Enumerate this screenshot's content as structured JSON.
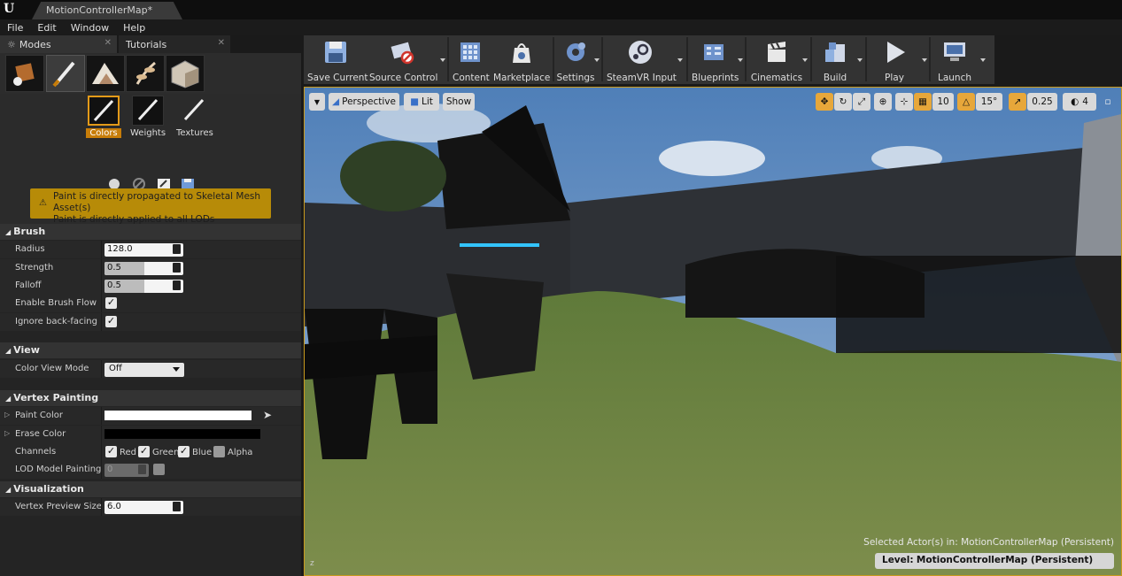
{
  "app": {
    "logo_icon": "unreal-logo-icon",
    "document_tab": "MotionControllerMap*"
  },
  "menu": [
    "File",
    "Edit",
    "Window",
    "Help"
  ],
  "left_tabs": [
    {
      "label": "Modes",
      "icon": "modes-icon"
    },
    {
      "label": "Tutorials"
    }
  ],
  "mode_icons": [
    "place-mode-icon",
    "paint-mode-icon",
    "landscape-mode-icon",
    "foliage-mode-icon",
    "geometry-mode-icon"
  ],
  "paint_tools": [
    {
      "label": "Colors",
      "active": true
    },
    {
      "label": "Weights",
      "active": false
    },
    {
      "label": "Textures",
      "active": false
    }
  ],
  "warning": {
    "line1": "Paint is directly propagated to Skeletal Mesh Asset(s)",
    "line2": "Paint is directly applied to all LODs"
  },
  "sections": {
    "brush": "Brush",
    "view": "View",
    "vertex_painting": "Vertex Painting",
    "visualization": "Visualization"
  },
  "brush": {
    "radius_label": "Radius",
    "radius": "128.0",
    "strength_label": "Strength",
    "strength": "0.5",
    "falloff_label": "Falloff",
    "falloff": "0.5",
    "flow_label": "Enable Brush Flow",
    "flow_checked": true,
    "backface_label": "Ignore back-facing",
    "backface_checked": true
  },
  "view": {
    "color_view_label": "Color View Mode",
    "color_view_value": "Off"
  },
  "vertex_painting": {
    "paint_color_label": "Paint Color",
    "paint_color": "#ffffff",
    "erase_color_label": "Erase Color",
    "erase_color": "#000000",
    "channels_label": "Channels",
    "channels": [
      {
        "label": "Red",
        "checked": true
      },
      {
        "label": "Green",
        "checked": true
      },
      {
        "label": "Blue",
        "checked": true
      },
      {
        "label": "Alpha",
        "checked": false
      }
    ],
    "lod_label": "LOD Model Painting",
    "lod_value": "0"
  },
  "visualization": {
    "vertex_size_label": "Vertex Preview Size",
    "vertex_size_value": "6.0"
  },
  "toolbar": [
    {
      "label": "Save Current",
      "icon": "save-icon",
      "arrow": false
    },
    {
      "label": "Source Control",
      "icon": "source-control-icon",
      "arrow": true
    },
    {
      "label": "Content",
      "icon": "content-icon",
      "arrow": false
    },
    {
      "label": "Marketplace",
      "icon": "marketplace-icon",
      "arrow": false
    },
    {
      "label": "Settings",
      "icon": "settings-icon",
      "arrow": true
    },
    {
      "label": "SteamVR Input",
      "icon": "steamvr-icon",
      "arrow": true
    },
    {
      "label": "Blueprints",
      "icon": "blueprints-icon",
      "arrow": true
    },
    {
      "label": "Cinematics",
      "icon": "cinematics-icon",
      "arrow": true
    },
    {
      "label": "Build",
      "icon": "build-icon",
      "arrow": true
    },
    {
      "label": "Play",
      "icon": "play-icon",
      "arrow": true
    },
    {
      "label": "Launch",
      "icon": "launch-icon",
      "arrow": true
    }
  ],
  "viewport": {
    "perspective": "Perspective",
    "lit": "Lit",
    "show": "Show",
    "grid_snap": "10",
    "rotation_snap": "15°",
    "scale_snap": "0.25",
    "camera_speed": "4",
    "selected_label": "Selected Actor(s) in:",
    "selected_value": "MotionControllerMap (Persistent)",
    "level_label": "Level:",
    "level_value": "MotionControllerMap (Persistent)"
  },
  "colors": {
    "accent": "#e39a19",
    "warning_bg": "#b78b08",
    "viewport_border": "#c99a1d"
  }
}
